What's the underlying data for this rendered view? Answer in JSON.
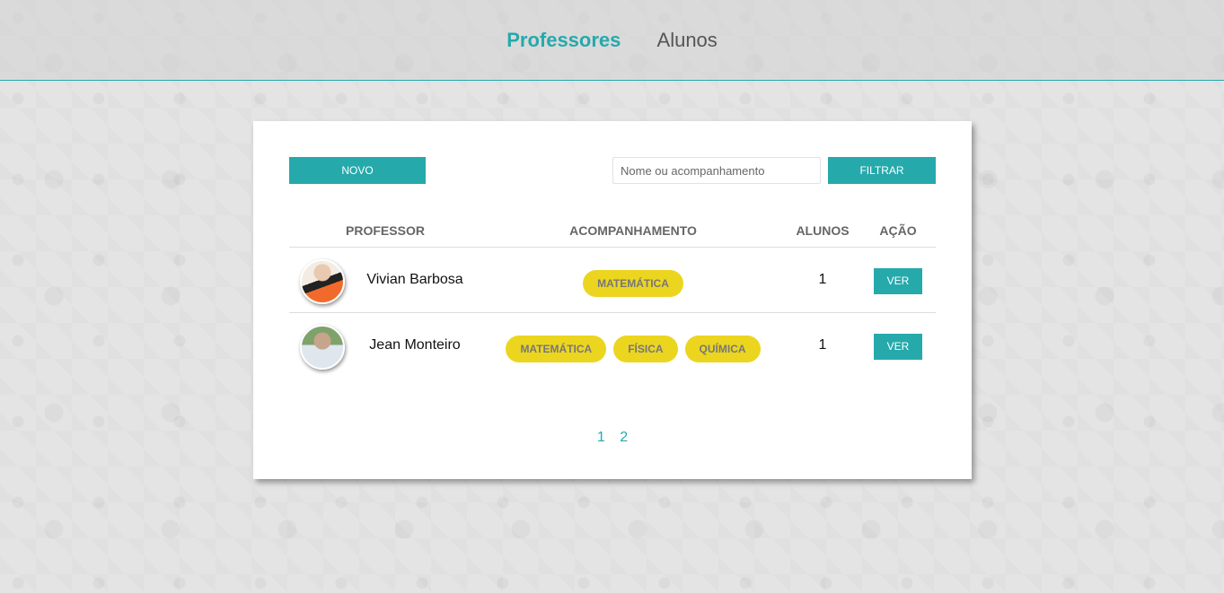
{
  "nav": {
    "professores": "Professores",
    "alunos": "Alunos"
  },
  "toolbar": {
    "novo_label": "NOVO",
    "search_placeholder": "Nome ou acompanhamento",
    "filtrar_label": "FILTRAR"
  },
  "table": {
    "headers": {
      "professor": "PROFESSOR",
      "acompanhamento": "ACOMPANHAMENTO",
      "alunos": "ALUNOS",
      "acao": "AÇÃO"
    },
    "rows": [
      {
        "name": "Vivian Barbosa",
        "tags": [
          "MATEMÁTICA"
        ],
        "alunos": "1",
        "action": "VER"
      },
      {
        "name": "Jean Monteiro",
        "tags": [
          "MATEMÁTICA",
          "FÍSICA",
          "QUÍMICA"
        ],
        "alunos": "1",
        "action": "VER"
      }
    ]
  },
  "pagination": [
    "1",
    "2"
  ],
  "colors": {
    "accent": "#26a9ab",
    "tag": "#ecd51f"
  }
}
